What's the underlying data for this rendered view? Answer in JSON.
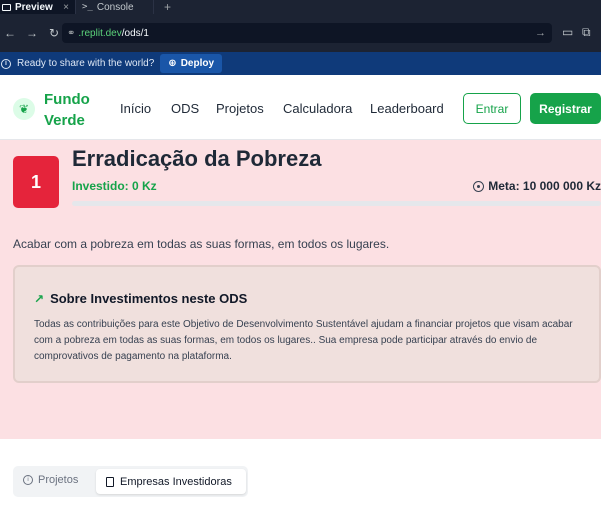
{
  "replit": {
    "tabs": [
      {
        "label": "Preview",
        "close": "×"
      },
      {
        "label": "Console"
      }
    ],
    "plus": "+",
    "url": {
      "host": ".replit.dev",
      "path": "/ods/1"
    },
    "banner": {
      "text": "Ready to share with the world?",
      "deploy_label": "Deploy"
    }
  },
  "site": {
    "brand_line1": "Fundo",
    "brand_line2": "Verde",
    "nav": [
      "Início",
      "ODS",
      "Projetos",
      "Calculadora",
      "Leaderboard"
    ],
    "login_label": "Entrar",
    "register_label": "Registrar"
  },
  "ods": {
    "number": "1",
    "title": "Erradicação da Pobreza",
    "invested": "Investido: 0 Kz",
    "goal": "Meta: 10 000 000 Kz",
    "progress_fraction": 0,
    "description": "Acabar com a pobreza em todas as suas formas, em todos os lugares.",
    "color": "#e5243b",
    "info_title": "Sobre Investimentos neste ODS",
    "info_text": "Todas as contribuições para este Objetivo de Desenvolvimento Sustentável ajudam a financiar projetos que visam acabar com a pobreza em todas as suas formas, em todos os lugares.. Sua empresa pode participar através do envio de comprovativos de pagamento na plataforma."
  },
  "tabs": {
    "projects_label": "Projetos",
    "companies_label": "Empresas Investidoras",
    "active": "Empresas Investidoras"
  },
  "colors": {
    "brand_green": "#16a34a",
    "hero_bg": "#fce0e3",
    "replit_dark": "#1c2333",
    "banner_blue": "#0f3a7a"
  }
}
